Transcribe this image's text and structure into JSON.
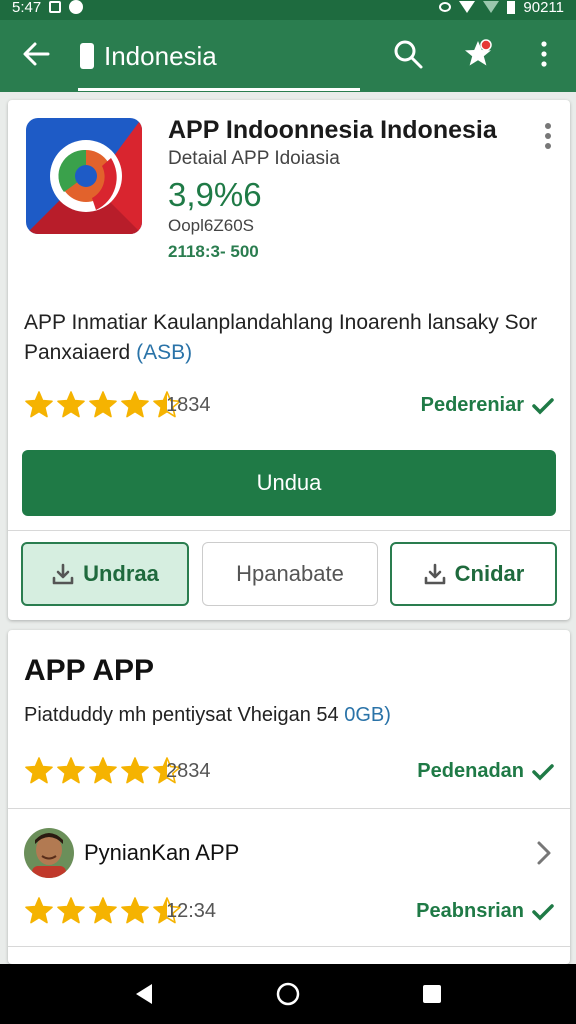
{
  "status_bar": {
    "time": "5:47",
    "right_text": "90211"
  },
  "app_bar": {
    "title": "Indonesia"
  },
  "app": {
    "name": "APP Indoonnesia Indonesia",
    "subtitle": "Detaial APP Idoiasia",
    "rating_value": "3,9%6",
    "meta_code": "Oopl6Z60S",
    "meta_number": "2118:3- 500",
    "description": "APP Inmatiar Kaulanplandahlang Inoarenh lansaky Sor Panxaiaerd",
    "description_accent": "(ASB)",
    "stars": 4.5,
    "rating_count": "1834",
    "verified_label": "Pedereniar",
    "primary_button": "Undua",
    "button_1": "Undraa",
    "button_2": "Hpanabate",
    "button_3": "Cnidar"
  },
  "section": {
    "title": "APP APP",
    "description": "Piatduddy mh pentiysat Vheigan 54",
    "description_accent": "0GB)",
    "stars": 4.5,
    "rating_count": "2834",
    "verified_label": "Pedenadan"
  },
  "list_item": {
    "name": "PynianKan APP",
    "stars": 4.5,
    "time": "12:34",
    "verified_label": "Peabnsrian"
  },
  "colors": {
    "primary": "#2a7d4f",
    "primary_dark": "#1f7a46",
    "star": "#f5b301",
    "accent": "#2a73a8"
  }
}
